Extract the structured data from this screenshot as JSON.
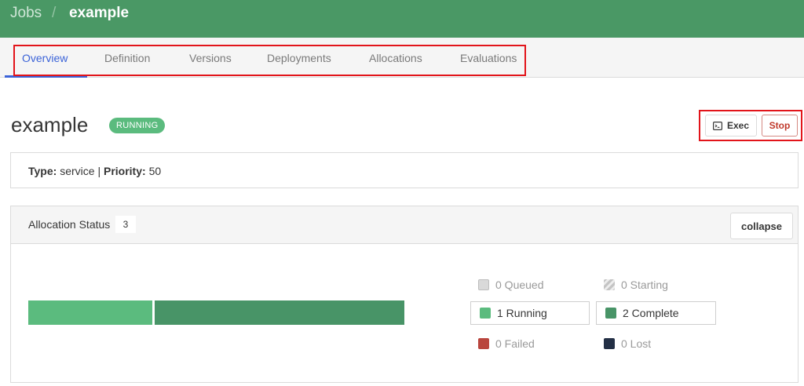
{
  "header": {
    "breadcrumb_root": "Jobs",
    "separator": "/",
    "breadcrumb_current": "example"
  },
  "tabs": [
    {
      "label": "Overview",
      "active": true
    },
    {
      "label": "Definition",
      "active": false
    },
    {
      "label": "Versions",
      "active": false
    },
    {
      "label": "Deployments",
      "active": false
    },
    {
      "label": "Allocations",
      "active": false
    },
    {
      "label": "Evaluations",
      "active": false
    }
  ],
  "job": {
    "title": "example",
    "status": "RUNNING",
    "exec_label": "Exec",
    "stop_label": "Stop"
  },
  "summary": {
    "type_label": "Type:",
    "type_value": "service",
    "divider": "|",
    "priority_label": "Priority:",
    "priority_value": "50"
  },
  "allocation_status": {
    "title": "Allocation Status",
    "count": "3",
    "collapse_label": "collapse",
    "bar": [
      {
        "state": "running",
        "value": 1
      },
      {
        "state": "complete",
        "value": 2
      }
    ],
    "legend": {
      "queued": "0 Queued",
      "starting": "0 Starting",
      "running": "1 Running",
      "complete": "2 Complete",
      "failed": "0 Failed",
      "lost": "0 Lost"
    }
  },
  "colors": {
    "header": "#4a9865",
    "active_tab": "#3b63d8",
    "running": "#5bbb7e",
    "complete": "#489467",
    "failed": "#b9453d",
    "lost": "#232f45",
    "stop": "#c0392b",
    "highlight": "#e2141a"
  },
  "icons": {
    "exec": "terminal-icon",
    "starting": "hatched-swatch"
  }
}
